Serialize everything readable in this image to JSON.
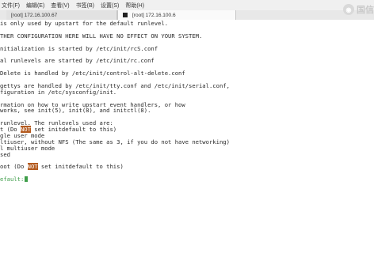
{
  "menu": {
    "items": [
      "文件(F)",
      "编辑(E)",
      "查看(V)",
      "书签(B)",
      "设置(S)",
      "帮助(H)"
    ]
  },
  "tabs": [
    {
      "label": "[root] 172.16.100.67",
      "active": false
    },
    {
      "label": "[root] 172.16.100.6",
      "active": true
    }
  ],
  "watermark": {
    "text": "国信"
  },
  "terminal": {
    "lines": [
      [
        {
          "t": "is only used by upstart for the default runlevel."
        }
      ],
      [
        {
          "t": ""
        }
      ],
      [
        {
          "t": "THER CONFIGURATION HERE WILL HAVE NO EFFECT ON YOUR SYSTEM."
        }
      ],
      [
        {
          "t": ""
        }
      ],
      [
        {
          "t": "nitialization is started by /etc/init/rcS.conf"
        }
      ],
      [
        {
          "t": ""
        }
      ],
      [
        {
          "t": "al runlevels are started by /etc/init/rc.conf"
        }
      ],
      [
        {
          "t": ""
        }
      ],
      [
        {
          "t": "Delete is handled by /etc/init/control-alt-delete.conf"
        }
      ],
      [
        {
          "t": ""
        }
      ],
      [
        {
          "t": "gettys are handled by /etc/init/tty.conf and /etc/init/serial.conf,"
        }
      ],
      [
        {
          "t": "figuration in /etc/sysconfig/init."
        }
      ],
      [
        {
          "t": ""
        }
      ],
      [
        {
          "t": "rmation on how to write upstart event handlers, or how"
        }
      ],
      [
        {
          "t": "works, see init(5), init(8), and initctl(8)."
        }
      ],
      [
        {
          "t": ""
        }
      ],
      [
        {
          "t": "runlevel. The runlevels used are:"
        }
      ],
      [
        {
          "t": "t (Do "
        },
        {
          "t": "NOT",
          "hl": true
        },
        {
          "t": " set initdefault to this)"
        }
      ],
      [
        {
          "t": "gle user mode"
        }
      ],
      [
        {
          "t": "ltiuser, without NFS (The same as 3, if you do not have networking)"
        }
      ],
      [
        {
          "t": "l multiuser mode"
        }
      ],
      [
        {
          "t": "sed"
        }
      ],
      [
        {
          "t": ""
        }
      ],
      [
        {
          "t": "oot (Do "
        },
        {
          "t": "NOT",
          "hl": true
        },
        {
          "t": " set initdefault to this)"
        }
      ],
      [
        {
          "t": ""
        }
      ],
      [
        {
          "t": "efault:",
          "green": true,
          "cursor": true
        }
      ]
    ]
  }
}
